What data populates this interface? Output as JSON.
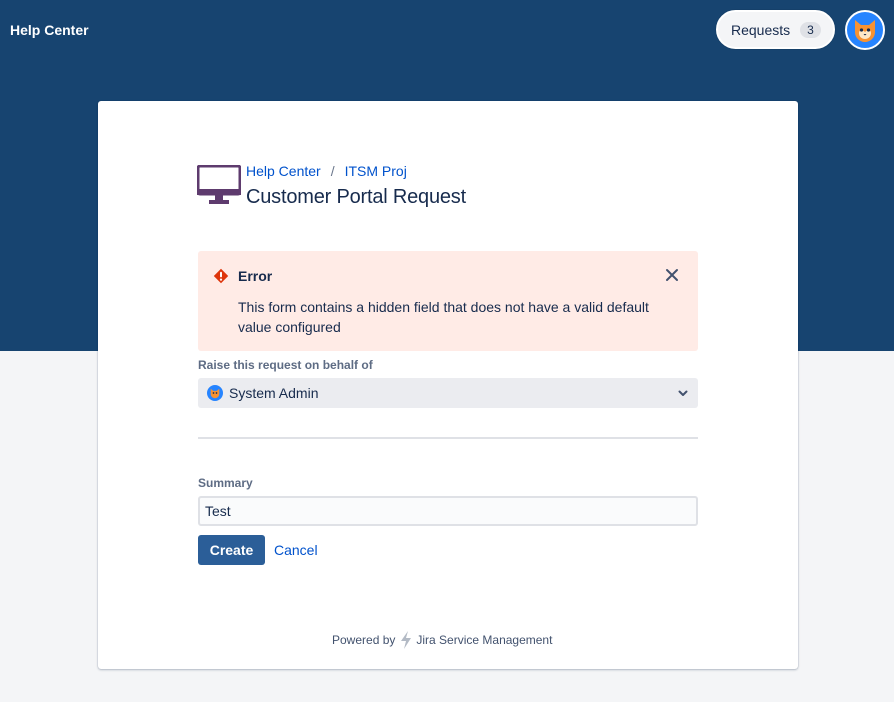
{
  "header": {
    "title": "Help Center",
    "requests_label": "Requests",
    "requests_count": "3"
  },
  "breadcrumb": {
    "home": "Help Center",
    "separator": "/",
    "project": "ITSM Proj"
  },
  "page_title": "Customer Portal Request",
  "error": {
    "title": "Error",
    "message": "This form contains a hidden field that does not have a valid default value configured"
  },
  "form": {
    "behalf_label": "Raise this request on behalf of",
    "behalf_value": "System Admin",
    "summary_label": "Summary",
    "summary_value": "Test",
    "create_label": "Create",
    "cancel_label": "Cancel"
  },
  "footer": {
    "powered_by": "Powered by",
    "product": "Jira Service Management"
  },
  "colors": {
    "banner": "#174470",
    "primary_button": "#2b5e98",
    "link": "#0052cc",
    "error_bg": "#ffebe6",
    "error_icon": "#de350b",
    "portal_icon": "#5e3b6e"
  },
  "icons": {
    "portal": "monitor-icon",
    "error": "error-icon",
    "close": "close-icon",
    "dropdown": "chevron-down-icon",
    "product": "bolt-icon",
    "avatar": "cat-avatar-icon"
  }
}
